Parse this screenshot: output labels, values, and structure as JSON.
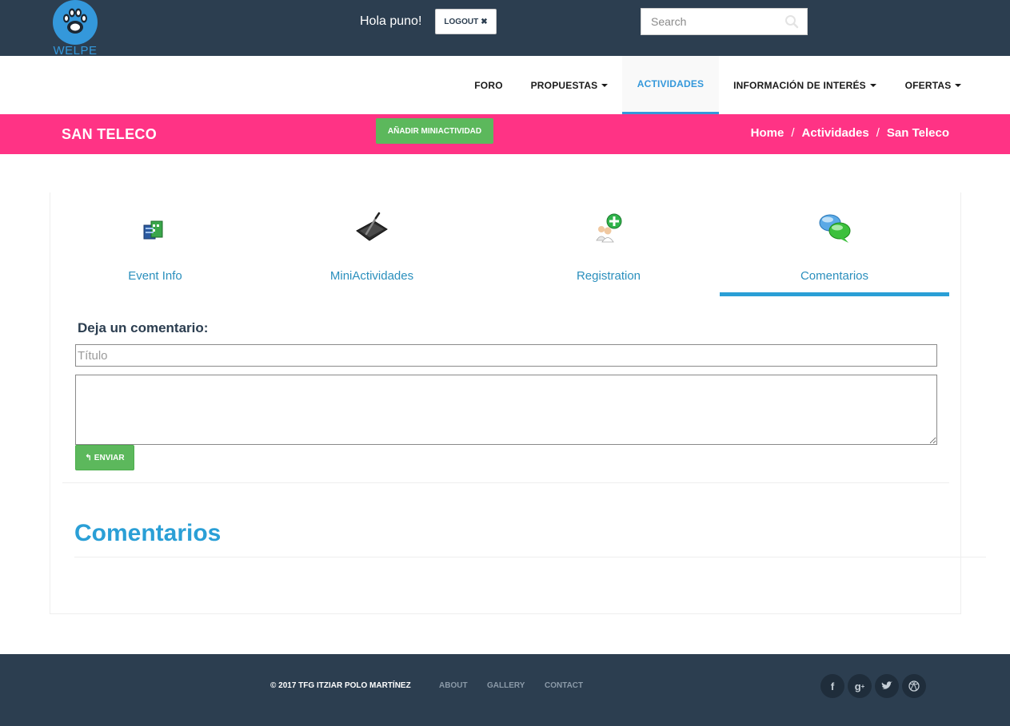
{
  "header": {
    "logo_text": "WELPE",
    "greeting": "Hola puno!",
    "logout_label": "LOGOUT",
    "search_placeholder": "Search"
  },
  "nav": {
    "items": [
      {
        "label": "FORO",
        "dropdown": false,
        "active": false
      },
      {
        "label": "PROPUESTAS",
        "dropdown": true,
        "active": false
      },
      {
        "label": "ACTIVIDADES",
        "dropdown": false,
        "active": true
      },
      {
        "label": "INFORMACIÓN DE INTERÉS",
        "dropdown": true,
        "active": false
      },
      {
        "label": "OFERTAS",
        "dropdown": true,
        "active": false
      }
    ]
  },
  "page_header": {
    "title": "SAN TELECO",
    "add_button_label": "AÑADIR MINIACTIVIDAD",
    "breadcrumb": [
      "Home",
      "Actividades",
      "San Teleco"
    ],
    "breadcrumb_separator": "/"
  },
  "tabs": [
    {
      "label": "Event Info",
      "icon": "calendar-document-icon",
      "active": false
    },
    {
      "label": "MiniActividades",
      "icon": "slate-pen-icon",
      "active": false
    },
    {
      "label": "Registration",
      "icon": "add-user-icon",
      "active": false
    },
    {
      "label": "Comentarios",
      "icon": "chat-bubbles-icon",
      "active": true
    }
  ],
  "comment_form": {
    "title": "Deja un comentario:",
    "title_placeholder": "Título",
    "body_value": "",
    "send_label": "ENVIAR"
  },
  "comments": {
    "heading": "Comentarios"
  },
  "footer": {
    "copyright": "© 2017 TFG ITZIAR POLO MARTÍNEZ",
    "links": [
      "ABOUT",
      "GALLERY",
      "CONTACT"
    ],
    "social": [
      "facebook-icon",
      "google-plus-icon",
      "twitter-icon",
      "dribbble-icon"
    ]
  },
  "colors": {
    "topbar": "#2c3e50",
    "accent_blue": "#2a9fd6",
    "pink": "#ff3385",
    "green": "#5cb85c"
  }
}
